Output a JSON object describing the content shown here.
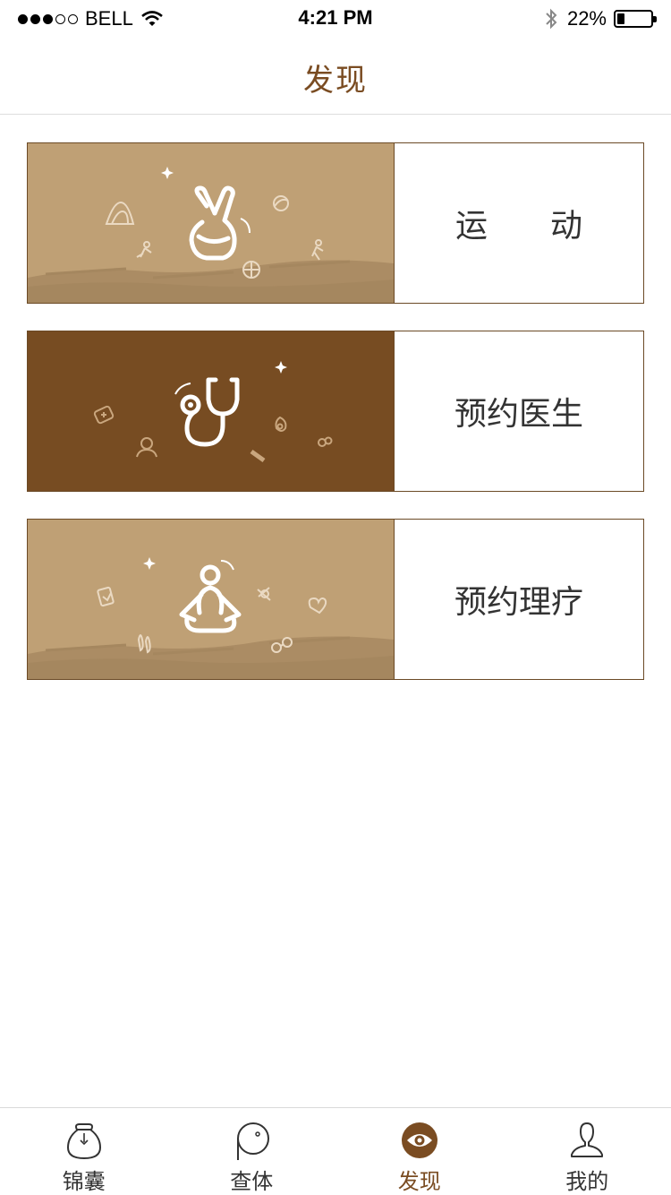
{
  "status_bar": {
    "carrier": "BELL",
    "time": "4:21 PM",
    "battery_percent": "22%",
    "battery_level": 0.22,
    "signal_bars": 3,
    "signal_total": 5
  },
  "nav": {
    "title": "发现"
  },
  "cards": [
    {
      "label": "运动",
      "icon": "victory-hand-icon",
      "bg": "#bfa075"
    },
    {
      "label": "预约医生",
      "icon": "stethoscope-icon",
      "bg": "#774c22"
    },
    {
      "label": "预约理疗",
      "icon": "meditation-icon",
      "bg": "#bfa075"
    }
  ],
  "tabs": [
    {
      "label": "锦囊",
      "icon": "pouch-icon",
      "active": false
    },
    {
      "label": "查体",
      "icon": "checkup-icon",
      "active": false
    },
    {
      "label": "发现",
      "icon": "eye-icon",
      "active": true
    },
    {
      "label": "我的",
      "icon": "person-icon",
      "active": false
    }
  ],
  "colors": {
    "accent": "#7a4c22",
    "tan": "#bfa075",
    "brown": "#774c22"
  }
}
